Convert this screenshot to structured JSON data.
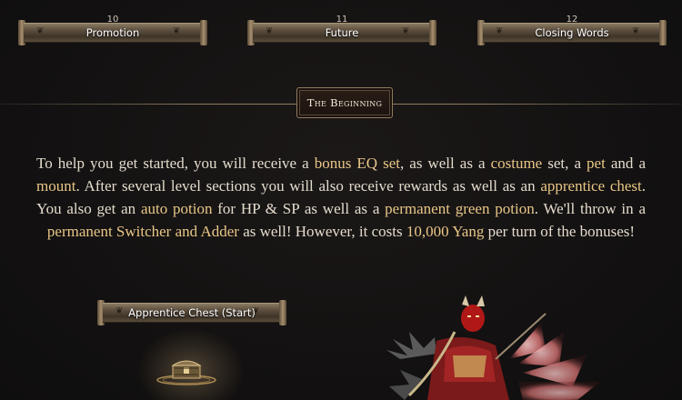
{
  "top_nav": {
    "items": [
      {
        "label": "Promotion",
        "number": "10"
      },
      {
        "label": "Future",
        "number": "11"
      },
      {
        "label": "Closing Words",
        "number": "12"
      }
    ]
  },
  "section": {
    "title": "The Beginning"
  },
  "intro": {
    "p1": "To help you get started, you will receive a ",
    "h1": "bonus EQ set",
    "p2": ", as well as a ",
    "h2": "costume",
    "p3": " set, a ",
    "h3": "pet",
    "p4": " and a ",
    "h4": "mount",
    "p5": ". After several level sections you will also receive rewards as well as an ",
    "h5": "apprentice chest",
    "p6": ". You also get an ",
    "h6": "auto potion",
    "p7": " for HP & SP as well as a ",
    "h7": "permanent green potion",
    "p8": ". We'll throw in a ",
    "h8": "permanent Switcher and Adder",
    "p9": " as well! However, it costs ",
    "h9": "10,000 Yang",
    "p10": " per turn of the bonuses!"
  },
  "chest": {
    "label": "Apprentice Chest (Start)"
  },
  "colors": {
    "highlight": "#e9c787",
    "text": "#e4dccd",
    "background": "#141212"
  }
}
